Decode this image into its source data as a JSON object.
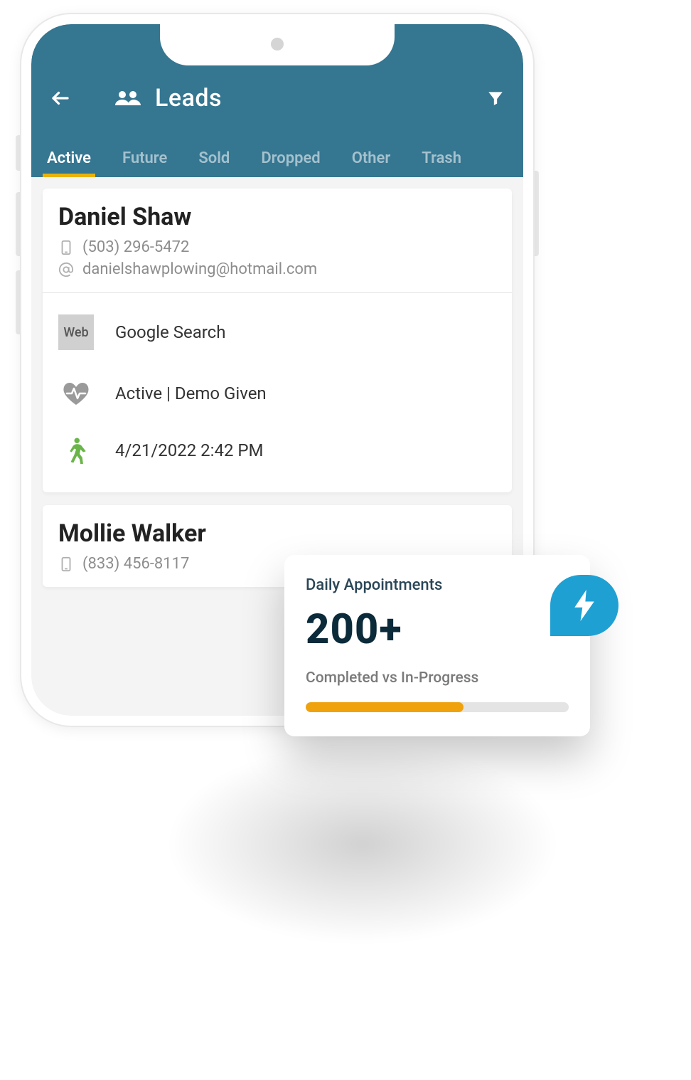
{
  "header": {
    "title": "Leads"
  },
  "tabs": [
    {
      "label": "Active",
      "active": true
    },
    {
      "label": "Future"
    },
    {
      "label": "Sold"
    },
    {
      "label": "Dropped"
    },
    {
      "label": "Other"
    },
    {
      "label": "Trash"
    }
  ],
  "leads": [
    {
      "name": "Daniel Shaw",
      "phone": "(503) 296-5472",
      "email": "danielshawplowing@hotmail.com",
      "source_badge": "Web",
      "source_text": "Google Search",
      "status": "Active | Demo Given",
      "timestamp": "4/21/2022 2:42 PM"
    },
    {
      "name": "Mollie Walker",
      "phone": "(833) 456-8117"
    }
  ],
  "stat": {
    "title": "Daily Appointments",
    "value": "200+",
    "subtitle": "Completed vs In-Progress",
    "progress_pct": 60
  }
}
